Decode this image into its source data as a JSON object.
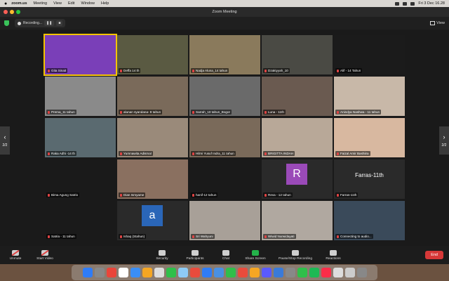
{
  "menubar": {
    "app": "zoom.us",
    "items": [
      "Meeting",
      "View",
      "Edit",
      "Window",
      "Help"
    ],
    "datetime": "Fri 3 Dec 16.28"
  },
  "window": {
    "title": "Zoom Meeting"
  },
  "topbar": {
    "recording_label": "Recording...",
    "view_label": "View"
  },
  "pager": {
    "page": "2/2"
  },
  "participants": [
    {
      "name": "Gita Sinait",
      "color": "#7a3fb8",
      "active": true
    },
    {
      "name": "Deffa 14 th",
      "color": "#5a5a42"
    },
    {
      "name": "Nadja Aluna_14 tahun",
      "color": "#8a7a5c"
    },
    {
      "name": "Dzakiyyah_10",
      "color": "#4a4a44"
    },
    {
      "name": "Alif - 14 Tahun",
      "color": "#1b1b1b"
    },
    {
      "name": "Prema_11 tahun",
      "color": "#8a8a8a"
    },
    {
      "name": "alunan syandana- 8 tahun",
      "color": "#7a6a5a"
    },
    {
      "name": "Sarrah_10 tahun_Bogor",
      "color": "#6a6a6a"
    },
    {
      "name": "Luna - 11th",
      "color": "#6a5a50"
    },
    {
      "name": "Anindya Nashwa - 11 tahun",
      "color": "#c8b8a8"
    },
    {
      "name": "Raka Adhi -14 th",
      "color": "#5a6a70"
    },
    {
      "name": "Yumnawita Adismal",
      "color": "#9a8a7a"
    },
    {
      "name": "Hilmi Yusuf Indra_11 tahun",
      "color": "#7a6a5a"
    },
    {
      "name": "BRIGITTA INDAH",
      "color": "#b8a898"
    },
    {
      "name": "Faizal Amir Bashiira",
      "color": "#d8b8a0"
    },
    {
      "name": "Bima Agung Satrio",
      "color": "#1a1a1a"
    },
    {
      "name": "Dian Ismyame",
      "color": "#8a7060"
    },
    {
      "name": "hanif-12 tahun",
      "color": "#1a1a1a"
    },
    {
      "name": "Reva - 12 tahun",
      "color": "#2a2a2a",
      "letter": "R",
      "letter_bg": "#9a4ab8"
    },
    {
      "name": "Farras-11th",
      "color": "#2a2a2a",
      "bigtext": "Farras-11th"
    },
    {
      "name": "Satria - 11 tahun",
      "color": "#1a1a1a"
    },
    {
      "name": "Ishaq (Stahun)",
      "color": "#2a2a2a",
      "letter": "a",
      "letter_bg": "#2a66b8"
    },
    {
      "name": "Sri Wahyuni",
      "color": "#a8a098"
    },
    {
      "name": "Wiwid Nurwidayati",
      "color": "#b0a8a0"
    },
    {
      "name": "Connecting to audio...",
      "color": "#3a4a5a"
    }
  ],
  "toolbar": {
    "unmute": "Unmute",
    "start_video": "Start Video",
    "security": "Security",
    "participants": "Participants",
    "participants_count": "28",
    "chat": "Chat",
    "chat_badge": "1",
    "share": "Share Screen",
    "record": "Pause/Stop Recording",
    "reactions": "Reactions",
    "end": "End"
  },
  "dock_colors": [
    "#2f7cf6",
    "#888",
    "#e9453a",
    "#fff",
    "#3a8ef6",
    "#f5a623",
    "#ddd",
    "#2fbf4a",
    "#8ecbf5",
    "#e94b3c",
    "#2f7cf6",
    "#4a90e2",
    "#2fbf4a",
    "#e94b3c",
    "#f5a623",
    "#5a5aff",
    "#3a7ad8",
    "#888",
    "#2fbf4a",
    "#1db954",
    "#fa2d48",
    "#ddd",
    "#ccc",
    "#888"
  ]
}
